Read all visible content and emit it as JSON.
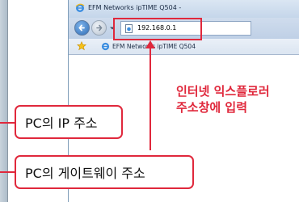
{
  "browser": {
    "window_title": "EFM Networks ipTIME Q504 -",
    "address_url": "192.168.0.1",
    "tab_title": "EFM Networks ipTIME Q504"
  },
  "annotations": {
    "callout_line1": "인터넷 익스플로러",
    "callout_line2": "주소창에 입력",
    "pc_ip_label": "PC의 IP 주소",
    "pc_gateway_label": "PC의 게이트웨이 주소"
  },
  "colors": {
    "accent_red": "#e0283c",
    "titlebar_blue": "#c5d6ea"
  },
  "icons": [
    "ie-icon",
    "back-arrow-icon",
    "forward-arrow-icon",
    "dropdown-arrow-icon",
    "page-icon",
    "favorites-star-icon"
  ]
}
